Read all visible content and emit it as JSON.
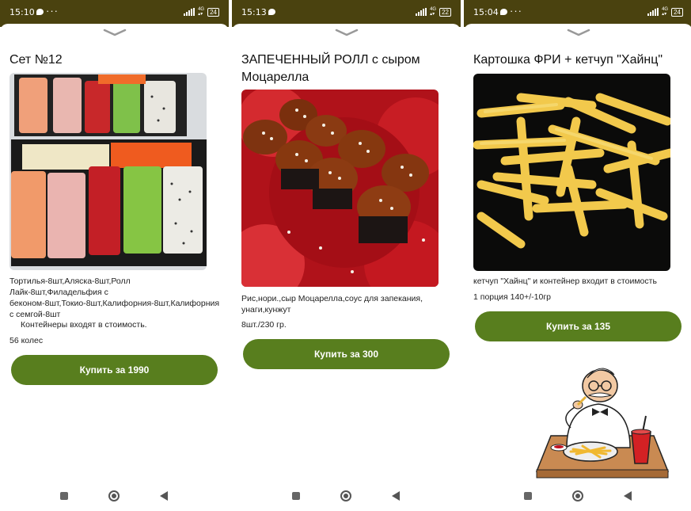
{
  "screens": [
    {
      "status_time": "15:10",
      "battery": "24",
      "title": "Сет №12",
      "description": "Тортилья-8шт,Аляска-8шт,Ролл Лайк-8шт,Филадельфия с беконом-8шт,Токио-8шт,Калифорния-8шт,Калифорния с семгой-8шт",
      "note": "Контейнеры входят в стоимость.",
      "extra": "56 колес",
      "buy_label": "Купить за 1990",
      "image": "sushi-set-photo"
    },
    {
      "status_time": "15:13",
      "battery": "22",
      "title": "ЗАПЕЧЕННЫЙ РОЛЛ с сыром Моцарелла",
      "description": "Рис,нори.,сыр Моцарелла,соус для запекания, унаги,кунжут",
      "extra": "8шт./230 гр.",
      "buy_label": "Купить за 300",
      "image": "baked-roll-photo"
    },
    {
      "status_time": "15:04",
      "battery": "24",
      "title": "Картошка ФРИ + кетчуп \"Хайнц\"",
      "description": "кетчуп \"Хайнц\" и контейнер  входит в стоимость",
      "extra": "1 порция 140+/-10гр",
      "buy_label": "Купить за 135",
      "image": "french-fries-photo"
    }
  ],
  "colors": {
    "status_bar": "#4a420f",
    "buy_button": "#587e1e"
  },
  "icons": [
    "chevron-down-icon",
    "signal-icon",
    "battery-icon",
    "nav-square-icon",
    "nav-home-icon",
    "nav-back-icon",
    "chef-eating-fries-illustration"
  ]
}
